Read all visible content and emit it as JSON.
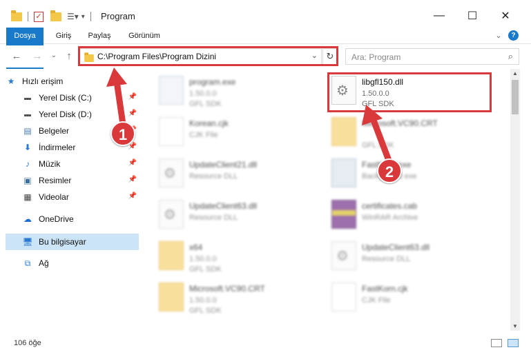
{
  "window": {
    "title": "Program",
    "minimize": "—",
    "maximize": "☐",
    "close": "✕"
  },
  "ribbon": {
    "tabs": [
      "Dosya",
      "Giriş",
      "Paylaş",
      "Görünüm"
    ],
    "expand": "⌄",
    "help": "?"
  },
  "address": {
    "path": "C:\\Program Files\\Program Dizini",
    "dropdown": "⌄",
    "refresh": "↻",
    "search_placeholder": "Ara: Program",
    "search_icon": "⌕"
  },
  "nav": {
    "back": "←",
    "forward": "→",
    "recent": "⌄",
    "up": "↑"
  },
  "sidebar": {
    "items": [
      {
        "label": "Hızlı erişim",
        "icon": "star-icon"
      },
      {
        "label": "Yerel Disk (C:)",
        "icon": "drive-icon",
        "pinned": true
      },
      {
        "label": "Yerel Disk (D:)",
        "icon": "drive-icon",
        "pinned": true
      },
      {
        "label": "Belgeler",
        "icon": "documents-icon",
        "pinned": true
      },
      {
        "label": "İndirmeler",
        "icon": "download-icon",
        "pinned": true
      },
      {
        "label": "Müzik",
        "icon": "music-icon",
        "pinned": true
      },
      {
        "label": "Resimler",
        "icon": "pictures-icon",
        "pinned": true
      },
      {
        "label": "Videolar",
        "icon": "videos-icon",
        "pinned": true
      },
      {
        "label": "OneDrive",
        "icon": "cloud-icon"
      },
      {
        "label": "Bu bilgisayar",
        "icon": "computer-icon",
        "selected": true
      },
      {
        "label": "Ağ",
        "icon": "network-icon"
      }
    ]
  },
  "files": [
    {
      "name": "program.exe",
      "line1": "1.50.0.0",
      "line2": "GFL SDK",
      "icon": "exe-icon",
      "blurred": true
    },
    {
      "name": "libgfl150.dll",
      "line1": "1.50.0.0",
      "line2": "GFL SDK",
      "icon": "dll-gear-icon",
      "blurred": false
    },
    {
      "name": "Korean.cjk",
      "line1": "CJK File",
      "line2": "",
      "icon": "blank-file-icon",
      "blurred": true
    },
    {
      "name": "Microsoft.VC90.CRT",
      "line1": "",
      "line2": "GFL SDK",
      "icon": "folder-icon",
      "blurred": true
    },
    {
      "name": "UpdateClient21.dll",
      "line1": "Resource DLL",
      "line2": "",
      "icon": "dll-gear-icon",
      "blurred": true
    },
    {
      "name": "FastKorn.exe",
      "line1": "Background exe",
      "line2": "",
      "icon": "window-exe-icon",
      "blurred": true
    },
    {
      "name": "UpdateClient63.dll",
      "line1": "Resource DLL",
      "line2": "",
      "icon": "dll-gear-icon",
      "blurred": true
    },
    {
      "name": "certificates.cab",
      "line1": "WinRAR Archive",
      "line2": "",
      "icon": "archive-icon",
      "blurred": true
    },
    {
      "name": "x64",
      "line1": "1.50.0.0",
      "line2": "GFL SDK",
      "icon": "folder-icon",
      "blurred": true
    },
    {
      "name": "UpdateClient63.dll",
      "line1": "Resource DLL",
      "line2": "",
      "icon": "dll-gear-icon",
      "blurred": true
    },
    {
      "name": "Microsoft.VC90.CRT",
      "line1": "1.50.0.0",
      "line2": "GFL SDK",
      "icon": "folder-icon",
      "blurred": true
    },
    {
      "name": "FastKorn.cjk",
      "line1": "CJK File",
      "line2": "",
      "icon": "blank-file-icon",
      "blurred": true
    }
  ],
  "annotations": {
    "step1": "1",
    "step2": "2",
    "color": "#d9393b"
  },
  "status": {
    "count": "106 öğe"
  }
}
